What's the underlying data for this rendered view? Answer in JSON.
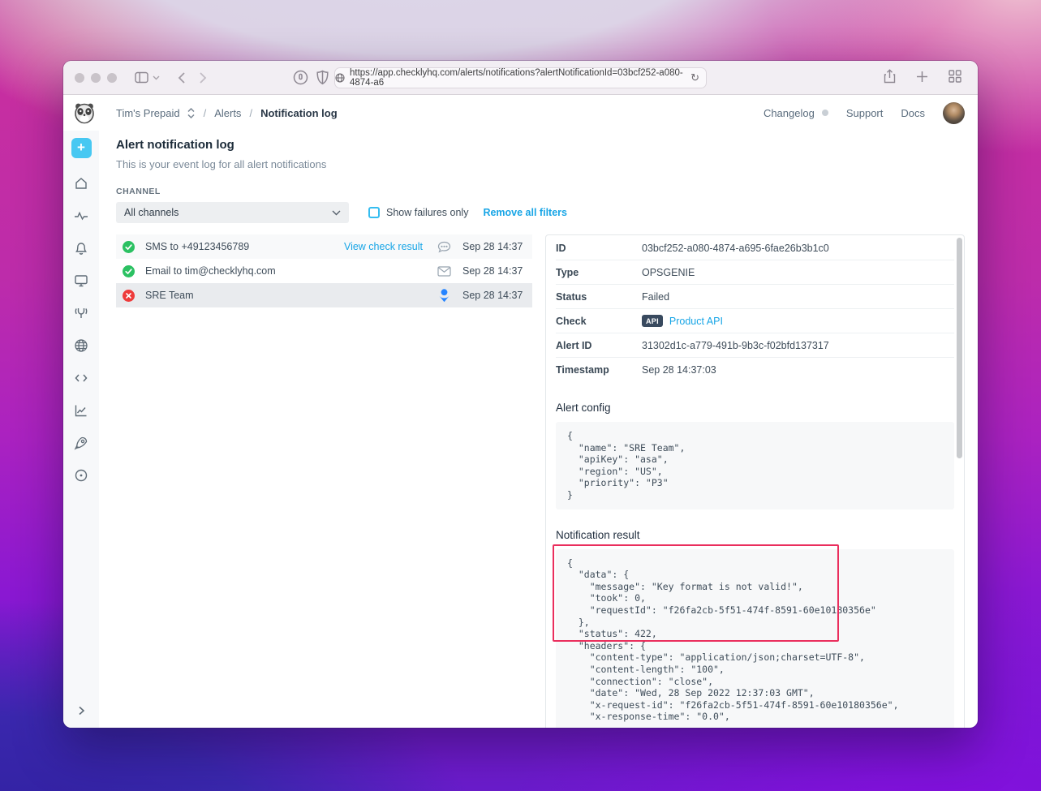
{
  "browser": {
    "url": "https://app.checklyhq.com/alerts/notifications?alertNotificationId=03bcf252-a080-4874-a6",
    "reload_icon": "reload"
  },
  "header": {
    "account": "Tim's Prepaid",
    "breadcrumb_alerts": "Alerts",
    "breadcrumb_current": "Notification log",
    "separator": "/",
    "nav": {
      "changelog": "Changelog",
      "support": "Support",
      "docs": "Docs"
    }
  },
  "sidebar": {
    "add_label": "+",
    "icons": [
      "home",
      "activity",
      "bell",
      "monitor",
      "wrench",
      "globe",
      "code",
      "chart",
      "rocket",
      "location"
    ]
  },
  "page": {
    "title": "Alert notification log",
    "subtitle": "This is your event log for all alert notifications",
    "filters": {
      "channel_label": "CHANNEL",
      "channel_value": "All channels",
      "failures_label": "Show failures only",
      "remove_label": "Remove all filters"
    },
    "notifications": [
      {
        "status": "success",
        "label": "SMS to +49123456789",
        "action": "View check result",
        "channel_icon": "speech-bubble",
        "time": "Sep 28 14:37"
      },
      {
        "status": "success",
        "label": "Email to tim@checklyhq.com",
        "channel_icon": "envelope",
        "time": "Sep 28 14:37"
      },
      {
        "status": "failed",
        "label": "SRE Team",
        "channel_icon": "opsgenie",
        "time": "Sep 28 14:37",
        "selected": true
      }
    ]
  },
  "details": {
    "fields": [
      {
        "label": "ID",
        "value": "03bcf252-a080-4874-a695-6fae26b3b1c0"
      },
      {
        "label": "Type",
        "value": "OPSGENIE"
      },
      {
        "label": "Status",
        "value": "Failed"
      },
      {
        "label": "Check",
        "badge": "API",
        "value": "Product API"
      },
      {
        "label": "Alert ID",
        "value": "31302d1c-a779-491b-9b3c-f02bfd137317"
      },
      {
        "label": "Timestamp",
        "value": "Sep 28 14:37:03"
      }
    ],
    "alert_config": {
      "title": "Alert config",
      "code": "{\n  \"name\": \"SRE Team\",\n  \"apiKey\": \"asa\",\n  \"region\": \"US\",\n  \"priority\": \"P3\"\n}"
    },
    "notification_result": {
      "title": "Notification result",
      "code": "{\n  \"data\": {\n    \"message\": \"Key format is not valid!\",\n    \"took\": 0,\n    \"requestId\": \"f26fa2cb-5f51-474f-8591-60e10180356e\"\n  },\n  \"status\": 422,\n  \"headers\": {\n    \"content-type\": \"application/json;charset=UTF-8\",\n    \"content-length\": \"100\",\n    \"connection\": \"close\",\n    \"date\": \"Wed, 28 Sep 2022 12:37:03 GMT\",\n    \"x-request-id\": \"f26fa2cb-5f51-474f-8591-60e10180356e\",\n    \"x-response-time\": \"0.0\","
    }
  },
  "colors": {
    "accent_cyan": "#17a5e6",
    "success_green": "#2bc162",
    "error_red": "#ee3b3b",
    "opsgenie_blue": "#2684ff",
    "annotation_red": "#ea2e5d",
    "sidebar_add_blue": "#47c8f2",
    "api_badge_bg": "#394a5f"
  }
}
